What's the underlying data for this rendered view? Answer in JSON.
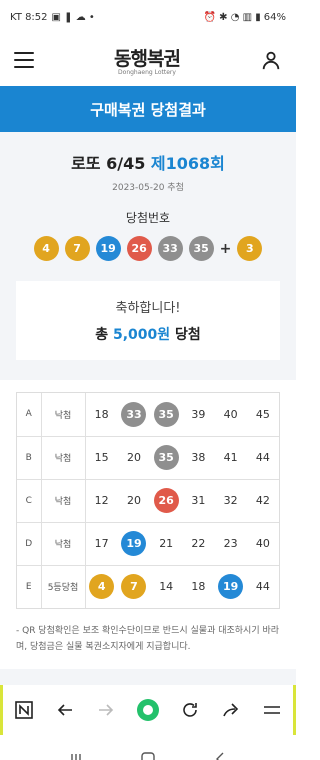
{
  "status_bar": {
    "carrier_time": "KT 8:52",
    "battery": "64%"
  },
  "header": {
    "logo_main": "동행복권",
    "logo_sub": "Donghaeng Lottery"
  },
  "banner": {
    "title": "구매복권 당첨결과"
  },
  "draw": {
    "game": "로또 6/45",
    "round": "제1068회",
    "date": "2023-05-20 추첨"
  },
  "winning": {
    "label": "당첨번호",
    "numbers": [
      "4",
      "7",
      "19",
      "26",
      "33",
      "35"
    ],
    "plus": "+",
    "bonus": "3"
  },
  "congrats": {
    "message": "축하합니다!",
    "prefix": "총",
    "amount": "5,000원",
    "suffix": "당첨"
  },
  "ticket_rows": [
    {
      "label": "A",
      "status": "낙첨",
      "numbers": [
        "18",
        "33",
        "35",
        "39",
        "40",
        "45"
      ]
    },
    {
      "label": "B",
      "status": "낙첨",
      "numbers": [
        "15",
        "20",
        "35",
        "38",
        "41",
        "44"
      ]
    },
    {
      "label": "C",
      "status": "낙첨",
      "numbers": [
        "12",
        "20",
        "26",
        "31",
        "32",
        "42"
      ]
    },
    {
      "label": "D",
      "status": "낙첨",
      "numbers": [
        "17",
        "19",
        "21",
        "22",
        "23",
        "40"
      ]
    },
    {
      "label": "E",
      "status": "5등당첨",
      "numbers": [
        "4",
        "7",
        "14",
        "18",
        "19",
        "44"
      ]
    }
  ],
  "note": "- QR 당첨확인은 보조 확인수단이므로 반드시 실물과 대조하시기 바라며, 당첨금은 실물 복권소지자에게 지급합니다.",
  "colors": {
    "accent": "#1a85d1",
    "yellow": "#e1a51f",
    "blue": "#2489d6",
    "red": "#e05a4a",
    "gray": "#8f8f8f"
  }
}
